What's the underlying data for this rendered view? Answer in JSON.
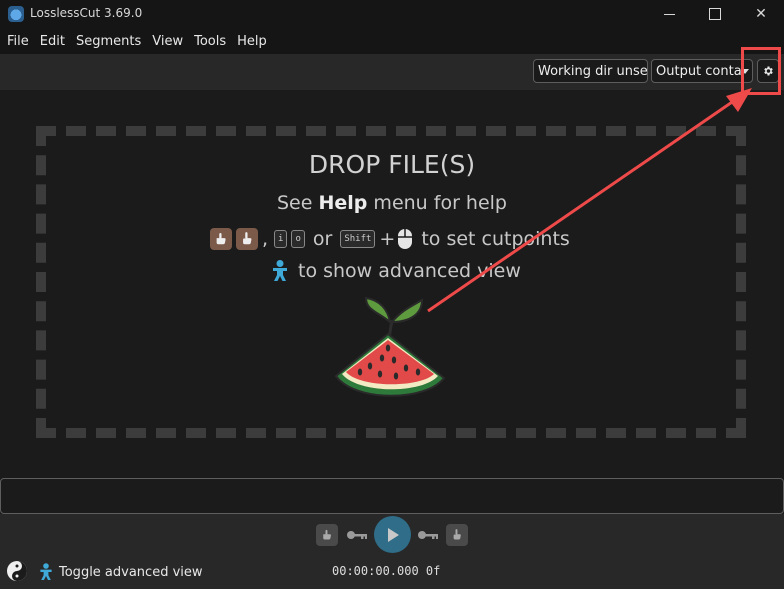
{
  "window": {
    "title": "LosslessCut 3.69.0",
    "controls": [
      "minimize",
      "maximize",
      "close"
    ]
  },
  "menu": [
    "File",
    "Edit",
    "Segments",
    "View",
    "Tools",
    "Help"
  ],
  "toolbar": {
    "working_dir": "Working dir unset",
    "output_container": "Output conta",
    "settings_icon": "gear-icon"
  },
  "drop_area": {
    "title": "DROP FILE(S)",
    "help_prefix": "See ",
    "help_bold": "Help",
    "help_suffix": " menu for help",
    "key_i": "i",
    "key_o": "o",
    "or_word": "or",
    "key_shift": "Shift",
    "plus": "+",
    "cutpoints_text": "to set cutpoints",
    "advanced_text": "to show advanced view"
  },
  "player": {
    "timecode": "00:00:00.000 0f",
    "toggle_advanced": "Toggle advanced view"
  },
  "colors": {
    "accent": "#2f6d88",
    "highlight": "#ef4a4a",
    "background": "#1b1b1b",
    "toolbar": "#282828"
  }
}
